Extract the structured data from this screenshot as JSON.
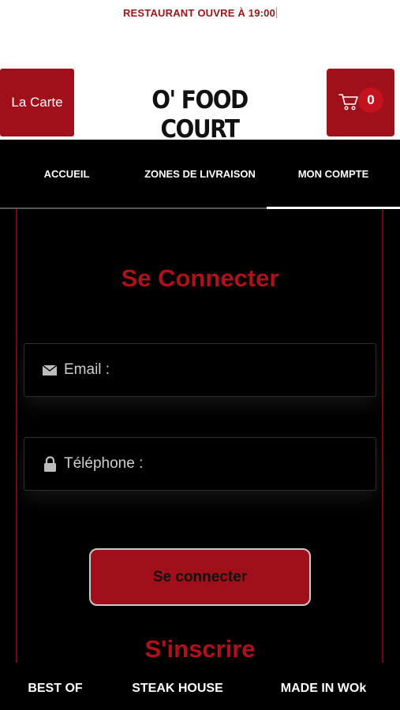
{
  "status_banner": "RESTAURANT OUVRE À 19:00",
  "header": {
    "menu_button": "La Carte",
    "brand": "O' FOOD COURT",
    "cart_count": "0",
    "cart_icon": "cart-icon"
  },
  "nav": {
    "tabs": [
      {
        "label": "ACCUEIL",
        "active": false
      },
      {
        "label": "ZONES DE LIVRAISON",
        "active": false
      },
      {
        "label": "MON COMPTE",
        "active": true
      }
    ]
  },
  "login": {
    "title": "Se Connecter",
    "email_placeholder": "Email :",
    "phone_placeholder": "Téléphone :",
    "submit_label": "Se connecter",
    "register_label": "S'inscrire"
  },
  "categories": [
    "BEST OF",
    "STEAK HOUSE",
    "MADE IN WOk"
  ],
  "colors": {
    "accent": "#a0101a",
    "title_red": "#b0101a",
    "background": "#000000"
  }
}
